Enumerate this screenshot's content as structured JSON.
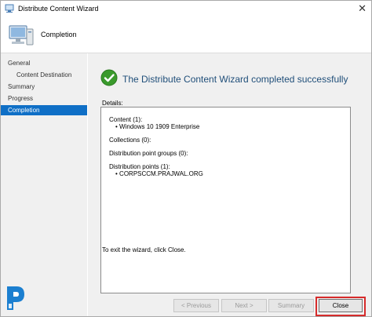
{
  "window": {
    "title": "Distribute Content Wizard",
    "close_glyph": "✕"
  },
  "header": {
    "title": "Completion"
  },
  "sidebar": {
    "items": [
      {
        "label": "General"
      },
      {
        "label": "Content Destination"
      },
      {
        "label": "Summary"
      },
      {
        "label": "Progress"
      },
      {
        "label": "Completion"
      }
    ],
    "active": "Completion"
  },
  "main": {
    "title": "The Distribute Content Wizard completed successfully",
    "details_label": "Details:",
    "details": {
      "content_heading": "Content (1):",
      "content_item": "Windows 10 1909 Enterprise",
      "collections": "Collections (0):",
      "dp_groups": "Distribution point groups (0):",
      "dp_heading": "Distribution points (1):",
      "dp_item": "CORPSCCM.PRAJWAL.ORG",
      "bullet": "•"
    },
    "exit_text": "To exit the wizard, click Close."
  },
  "buttons": {
    "previous": "< Previous",
    "next": "Next >",
    "summary": "Summary",
    "close": "Close"
  },
  "colors": {
    "accent": "#0f6fc6",
    "title_blue": "#1f4e79",
    "success_green": "#3a9a2c",
    "highlight_red": "#d62b2b"
  }
}
